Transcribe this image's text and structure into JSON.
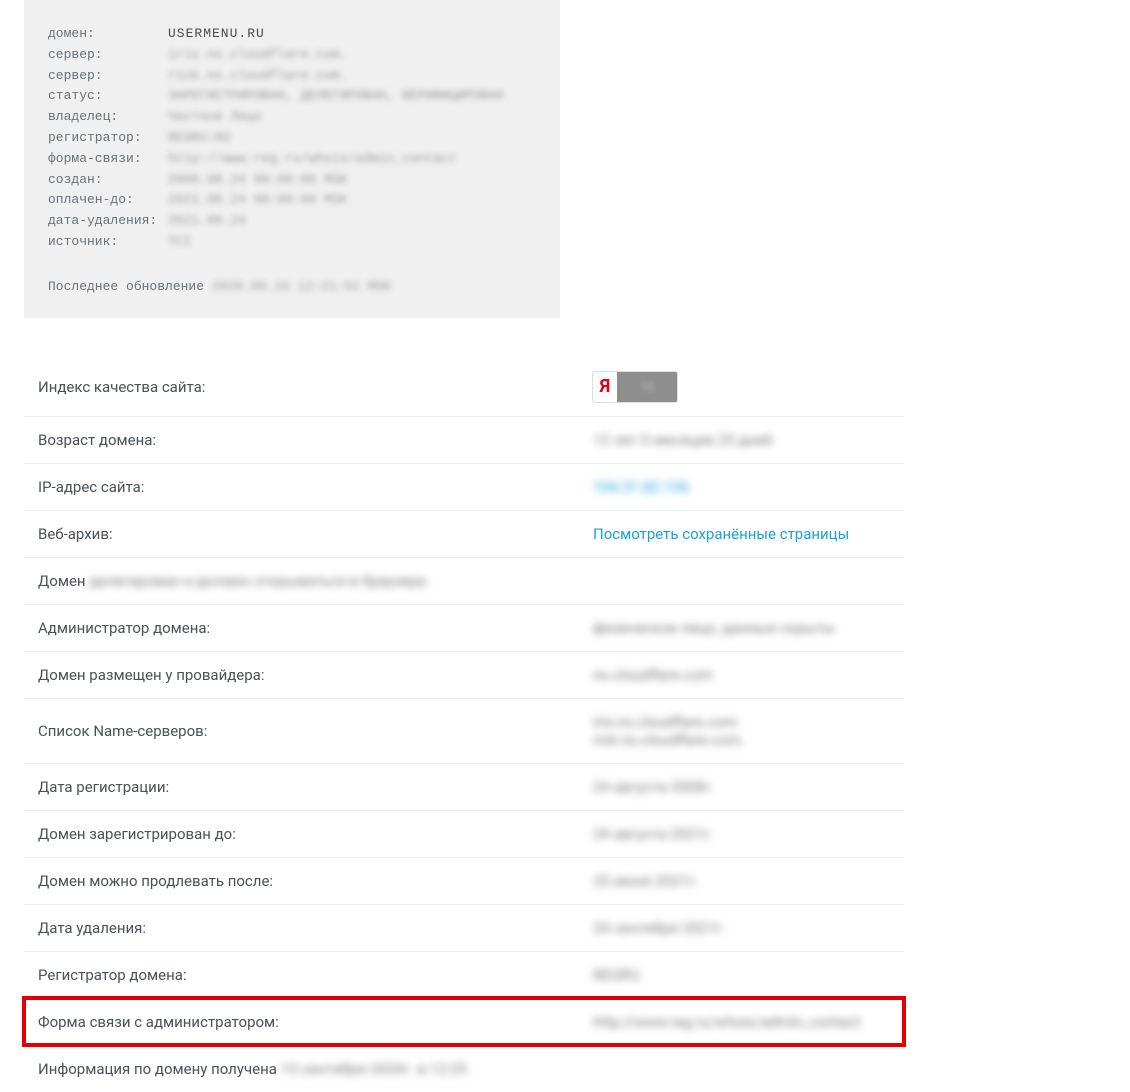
{
  "whois": {
    "rows": [
      {
        "label": "домен:",
        "value": "USERMENU.RU",
        "blur": false
      },
      {
        "label": "сервер:",
        "value": "iris.ns.cloudflare.com.",
        "blur": true
      },
      {
        "label": "сервер:",
        "value": "rick.ns.cloudflare.com.",
        "blur": true
      },
      {
        "label": "статус:",
        "value": "ЗАРЕГИСТРИРОВАН, ДЕЛЕГИРОВАН, ВЕРИФИЦИРОВАН",
        "blur": true
      },
      {
        "label": "владелец:",
        "value": "Частное Лицо",
        "blur": true
      },
      {
        "label": "регистратор:",
        "value": "REGRU-RU",
        "blur": true
      },
      {
        "label": "форма-связи:",
        "value": "http://www.reg.ru/whois/admin_contact",
        "blur": true
      },
      {
        "label": "создан:",
        "value": "2008.08.24 00:00:00 MSK",
        "blur": true
      },
      {
        "label": "оплачен-до:",
        "value": "2021.08.24 00:00:00 MSK",
        "blur": true
      },
      {
        "label": "дата-удаления:",
        "value": "2021.09.24",
        "blur": true
      },
      {
        "label": "источник:",
        "value": "TCI",
        "blur": true
      }
    ],
    "update_prefix": "Последнее обновление",
    "update_date": "2020.09.15 12:21:51 MSK"
  },
  "info": {
    "quality_label": "Индекс качества сайта:",
    "ya_letter": "Я",
    "ya_score": "10",
    "age_label": "Возраст домена:",
    "age_value": "12 лет 0 месяцев 25 дней",
    "ip_label": "IP-адрес сайта:",
    "ip_value": "104.31.82.136",
    "archive_label": "Веб-архив:",
    "archive_value": "Посмотреть сохранённые страницы",
    "delegated_prefix": "Домен",
    "delegated_suffix": "делегирован и должен открываться в браузере.",
    "admin_label": "Администратор домена:",
    "admin_value": "физическое лицо, данные скрыты",
    "provider_label": "Домен размещен у провайдера:",
    "provider_value": "ns.cloudflare.com",
    "ns_label": "Список Name-серверов:",
    "ns_value1": "iris.ns.cloudflare.com.",
    "ns_value2": "rick.ns.cloudflare.com.",
    "reg_date_label": "Дата регистрации:",
    "reg_date_value": "24 августа 2008г.",
    "reg_until_label": "Домен зарегистрирован до:",
    "reg_until_value": "24 августа 2021г.",
    "renew_after_label": "Домен можно продлевать после:",
    "renew_after_value": "25 июня 2021г.",
    "delete_date_label": "Дата удаления:",
    "delete_date_value": "24 сентября 2021г.",
    "registrar_label": "Регистратор домена:",
    "registrar_value": "REGRU",
    "contact_form_label": "Форма связи с администратором:",
    "contact_form_value": "http://www.reg.ru/whois/admin_contact",
    "footer_prefix": "Информация по домену получена",
    "footer_date": "15 сентября 2020г. в 12:25"
  }
}
